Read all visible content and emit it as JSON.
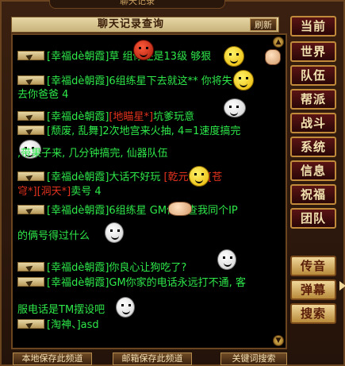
{
  "window_title": "聊天记录",
  "header": {
    "title": "聊天记录查询",
    "refresh_label": "刷新"
  },
  "side_menu": [
    {
      "label": "当前",
      "style": "red"
    },
    {
      "label": "世界",
      "style": "red"
    },
    {
      "label": "队伍",
      "style": "red"
    },
    {
      "label": "帮派",
      "style": "red"
    },
    {
      "label": "战斗",
      "style": "red"
    },
    {
      "label": "系统",
      "style": "red"
    },
    {
      "label": "信息",
      "style": "red"
    },
    {
      "label": "祝福",
      "style": "red"
    },
    {
      "label": "团队",
      "style": "red"
    },
    {
      "label": "传音",
      "style": "gold"
    },
    {
      "label": "弹幕",
      "style": "gold"
    },
    {
      "label": "搜索",
      "style": "gold"
    }
  ],
  "chat_lines": [
    {
      "parts": [
        {
          "t": "[幸福dè朝霞]草"
        },
        {
          "t": "      组你还是13级"
        },
        {
          "t": "      够狠"
        }
      ]
    },
    {
      "parts": [
        {
          "t": "[幸福dè朝霞]6组练星下去就这**"
        },
        {
          "t": "   你将失"
        }
      ]
    },
    {
      "parts": [
        {
          "t": "去你爸爸 4"
        }
      ]
    },
    {
      "parts": [
        {
          "t": "[幸福dè朝霞]"
        },
        {
          "t": "[地瞄星*]",
          "c": "red"
        },
        {
          "t": "坑爹玩意"
        }
      ]
    },
    {
      "parts": [
        {
          "t": "[颓废, 乱舞]2次地宫来火抽, 4=1速度搞完"
        }
      ]
    },
    {
      "parts": [
        {
          "t": "     ,带果子来, 几分钟搞完, 仙器队伍"
        }
      ]
    },
    {
      "parts": [
        {
          "t": "[幸福dè朝霞]大话不好玩"
        },
        {
          "t": "      [乾元镜*][苍",
          "c": "red"
        }
      ]
    },
    {
      "parts": [
        {
          "t": "穹*][洞天*]",
          "c": "red"
        },
        {
          "t": "卖号 4"
        }
      ]
    },
    {
      "parts": [
        {
          "t": "[幸福dè朝霞]6组练星"
        },
        {
          "t": "      GM你查查我同个IP"
        }
      ]
    },
    {
      "parts": [
        {
          "t": "的俩号得过什么"
        }
      ]
    },
    {
      "parts": [
        {
          "t": "[幸福dè朝霞]你良心让狗吃了?"
        }
      ]
    },
    {
      "parts": [
        {
          "t": "[幸福dè朝霞]GM你家的电话永远打不通, 客"
        }
      ]
    },
    {
      "parts": [
        {
          "t": "服电话是TM摆设吧"
        }
      ]
    },
    {
      "parts": [
        {
          "t": "[淘神、]asd"
        }
      ]
    }
  ],
  "bottom_buttons": [
    {
      "label": "本地保存此频道"
    },
    {
      "label": "邮箱保存此频道"
    },
    {
      "label": "关键词搜索"
    }
  ],
  "colors": {
    "chat_text": "#2ee84a",
    "item_link": "#e3321e",
    "accent_gold": "#c08a3a"
  },
  "icons": [
    "trumpet-icon",
    "devil-emoticon",
    "grin-emoticon",
    "thumbs-up-emoticon",
    "smirk-emoticon",
    "bunny-emoticon",
    "handshake-emoticon",
    "scroll-up-icon",
    "scroll-down-icon"
  ]
}
